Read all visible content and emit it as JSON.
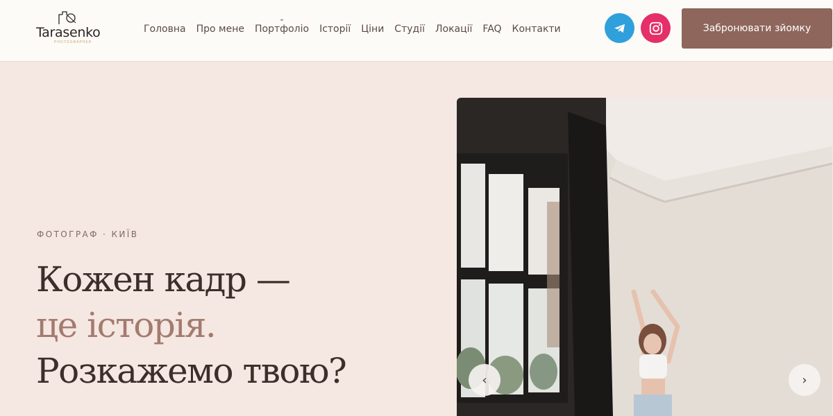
{
  "logo": {
    "word": "Tarasenko",
    "sub": "PHOTOGRAPHER"
  },
  "nav": {
    "items": [
      {
        "label": "Головна"
      },
      {
        "label": "Про мене"
      },
      {
        "label": "Портфоліо",
        "has_dropdown": true
      },
      {
        "label": "Історії"
      },
      {
        "label": "Ціни"
      },
      {
        "label": "Студії"
      },
      {
        "label": "Локації"
      },
      {
        "label": "FAQ"
      },
      {
        "label": "Контакти"
      }
    ]
  },
  "social": {
    "telegram_icon": "telegram-icon",
    "instagram_icon": "instagram-icon",
    "telegram_color": "#2fa0db",
    "instagram_color": "#e42f68"
  },
  "cta": {
    "label": "Забронювати зйомку",
    "color": "#8e665c"
  },
  "hero": {
    "eyebrow": "ФОТОГРАФ · КИЇВ",
    "line1": "Кожен кадр —",
    "line2": "це історія.",
    "line3": "Розкажемо твою?",
    "accent_color": "#a37b6f"
  },
  "slider": {
    "prev_icon": "‹",
    "next_icon": "›"
  }
}
